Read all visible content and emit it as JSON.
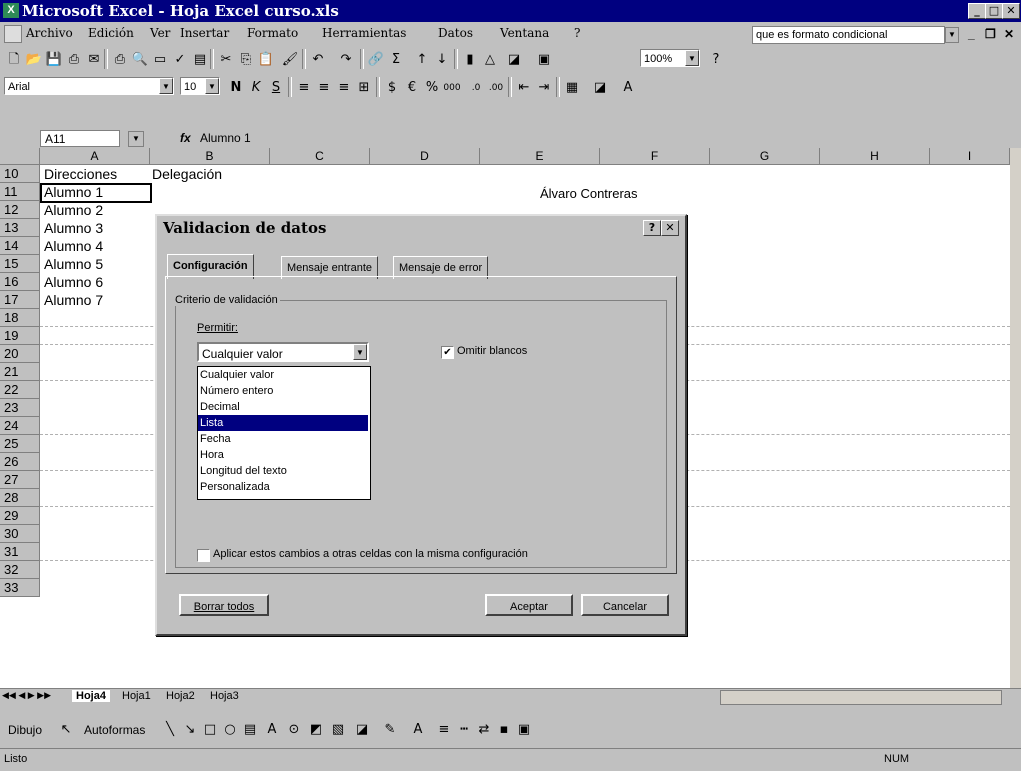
{
  "window": {
    "title": "Microsoft Excel - Hoja Excel curso.xls"
  },
  "menu": {
    "items": [
      "Archivo",
      "Edición",
      "Ver",
      "Insertar",
      "Formato",
      "Herramientas",
      "Datos",
      "Ventana",
      "?"
    ],
    "ask_box": "que es formato condicional"
  },
  "format_toolbar": {
    "font": "Arial",
    "size": "10",
    "zoom": "100%"
  },
  "formula_bar": {
    "name_box": "A11",
    "fx": "fx",
    "content": "Alumno 1"
  },
  "grid": {
    "columns": [
      "A",
      "B",
      "C",
      "D",
      "E",
      "F",
      "G",
      "H",
      "I"
    ],
    "rows": [
      "10",
      "11",
      "12",
      "13",
      "14",
      "15",
      "16",
      "17",
      "18",
      "19",
      "20",
      "21",
      "22",
      "23",
      "24",
      "25",
      "26",
      "27",
      "28",
      "29",
      "30",
      "31",
      "32",
      "33"
    ],
    "cells": {
      "a10": "Direcciones",
      "b10": "Delegación",
      "a11": "Alumno 1",
      "a12": "Alumno 2",
      "a13": "Alumno 3",
      "a14": "Alumno 4",
      "a15": "Alumno 5",
      "a16": "Alumno 6",
      "a17": "Alumno 7",
      "d11": "Álvaro Contreras"
    }
  },
  "sheet_tabs": [
    "Hoja4",
    "Hoja1",
    "Hoja2",
    "Hoja3"
  ],
  "drawing_toolbar": {
    "dibujo": "Dibujo",
    "autoformas": "Autoformas"
  },
  "status_bar": {
    "left": "Listo",
    "num": "NUM"
  },
  "dialog": {
    "title": "Validacion de datos",
    "tabs": [
      "Configuración",
      "Mensaje entrante",
      "Mensaje de error"
    ],
    "group_label": "Criterio de validación",
    "allow_label": "Permitir:",
    "allow_value": "Cualquier valor",
    "options": [
      "Cualquier valor",
      "Número entero",
      "Decimal",
      "Lista",
      "Fecha",
      "Hora",
      "Longitud del texto",
      "Personalizada"
    ],
    "selected_option": "Lista",
    "ignore_blank": "Omitir blancos",
    "apply_all": "Aplicar estos cambios a otras celdas con la misma configuración",
    "clear_button": "Borrar todos",
    "ok_button": "Aceptar",
    "cancel_button": "Cancelar"
  }
}
